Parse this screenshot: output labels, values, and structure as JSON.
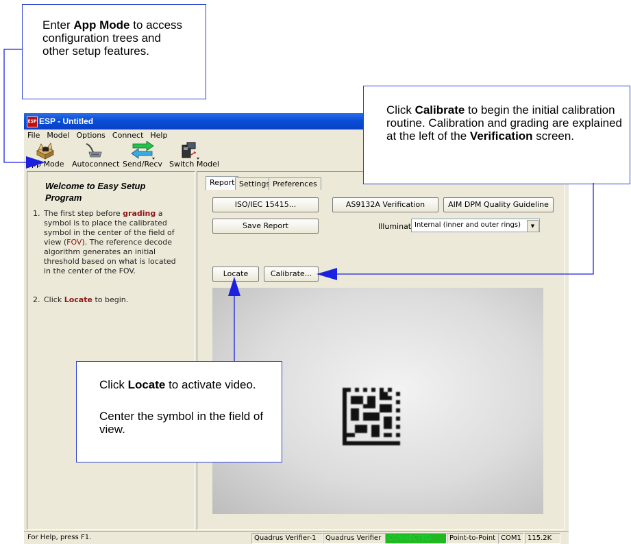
{
  "window": {
    "title": "ESP - Untitled",
    "logo_text": "ESP",
    "menu": [
      "File",
      "Model",
      "Options",
      "Connect",
      "Help"
    ],
    "toolbar": [
      {
        "label": "App Mode",
        "icon": "app-mode-icon"
      },
      {
        "label": "Autoconnect",
        "icon": "cable-connector-icon"
      },
      {
        "label": "Send/Recv",
        "icon": "send-recv-arrows-icon"
      },
      {
        "label": "Switch Model",
        "icon": "switch-model-icon"
      }
    ]
  },
  "left_panel": {
    "title": "Welcome to Easy Setup Program",
    "step1": {
      "num": "1.",
      "t1": "The first step before ",
      "kw1": "grading",
      "t2": " a symbol is to place the calibrated symbol in the center of the field of view (",
      "kw2": "FOV",
      "t3": "). The reference decode algorithm generates an initial threshold based on what is located in the center of the FOV."
    },
    "step2": {
      "num": "2.",
      "t1": "Click ",
      "kw1": "Locate",
      "t2": " to begin."
    }
  },
  "right_panel": {
    "tabs": [
      "Report",
      "Settings",
      "Preferences"
    ],
    "buttons": {
      "iso": "ISO/IEC 15415...",
      "as9132a": "AS9132A Verification",
      "aim": "AIM DPM Quality Guideline",
      "save_report": "Save Report",
      "locate": "Locate",
      "calibrate": "Calibrate..."
    },
    "illumination_label": "Illumination",
    "illumination_value": "Internal (inner and outer rings)"
  },
  "statusbar": {
    "help": "For Help, press F1.",
    "device": "Quadrus Verifier-1",
    "model": "Quadrus Verifier",
    "status": "CONNECTED",
    "mode": "Point-to-Point",
    "port": "COM1",
    "baud": "115.2K"
  },
  "colors": {
    "callout_border": "#2a3fd0",
    "arrow": "#1a22e0",
    "keyword": "#8b1515",
    "connected": "#21b821"
  },
  "callouts": {
    "app_mode": {
      "t1": "Enter ",
      "b1": "App Mode",
      "t2": " to access configuration trees and other setup features."
    },
    "calibrate": {
      "t1": "Click ",
      "b1": "Calibrate",
      "t2": " to begin the initial calibration routine. Calibration and grading are explained at the left of the ",
      "b2": "Verification",
      "t3": " screen."
    },
    "locate": {
      "t1": "Click ",
      "b1": "Locate",
      "t2": " to activate video.",
      "line2": "Center the symbol in the field of view."
    }
  }
}
